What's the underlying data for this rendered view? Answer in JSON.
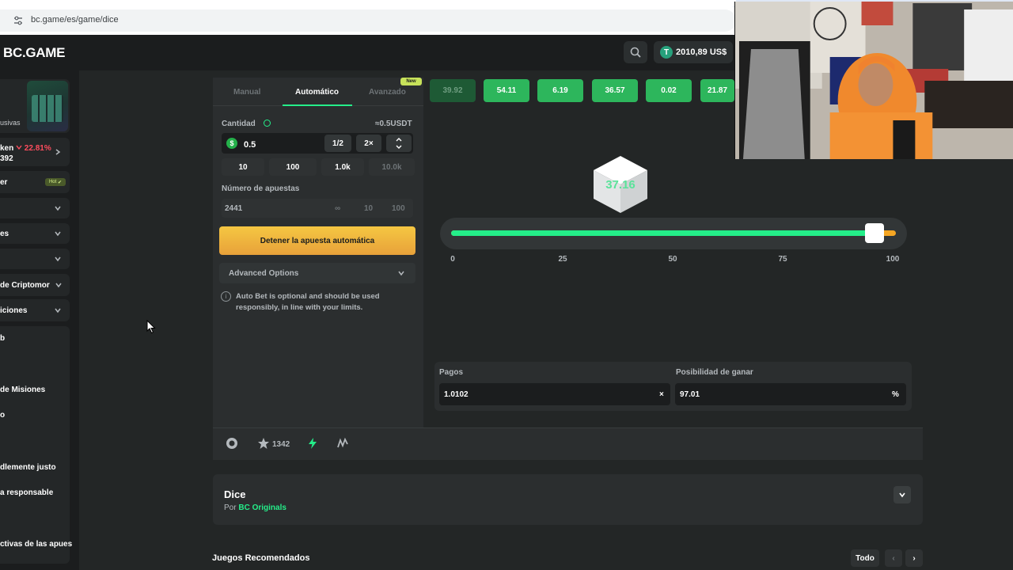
{
  "browser": {
    "url": "bc.game/es/game/dice"
  },
  "header": {
    "logo": "BC.GAME",
    "balance": "2010,89 US$",
    "balance_coin": "T"
  },
  "sidebar": {
    "promo_caption": "usivas",
    "token": {
      "name": "ken",
      "change": "22.81%",
      "value": "392"
    },
    "items": [
      {
        "label": "er",
        "badge": "Hot"
      },
      {
        "label": ""
      },
      {
        "label": "es"
      },
      {
        "label": ""
      },
      {
        "label": "de Criptomor"
      },
      {
        "label": "iciones"
      },
      {
        "label": "b"
      },
      {
        "label": "de Misiones"
      },
      {
        "label": "o"
      },
      {
        "label": "dlemente justo"
      },
      {
        "label": "a responsable"
      },
      {
        "label": "ctivas de las apues"
      }
    ]
  },
  "panel": {
    "tabs": [
      "Manual",
      "Automático",
      "Avanzado"
    ],
    "active_tab": "Automático",
    "new_badge": "New",
    "amount_label": "Cantidad",
    "amount_approx": "≈0.5USDT",
    "amount_value": "0.5",
    "amount_coin": "$",
    "half_btn": "1/2",
    "double_btn": "2×",
    "presets": [
      "10",
      "100",
      "1.0k",
      "10.0k"
    ],
    "bets_label": "Número de apuestas",
    "bets_value": "2441",
    "bets_options": [
      "∞",
      "10",
      "100"
    ],
    "stop_button": "Detener la apuesta automática",
    "advanced_label": "Advanced Options",
    "note_icon": "i",
    "note": "Auto Bet is optional and should be used responsibly, in line with your limits."
  },
  "game": {
    "history": [
      "39.92",
      "54.11",
      "6.19",
      "36.57",
      "0.02",
      "21.87"
    ],
    "result": "37.16",
    "slider_value": 97.01,
    "ticks": [
      "0",
      "25",
      "50",
      "75",
      "100"
    ],
    "payout_label": "Pagos",
    "payout_value": "1.0102",
    "payout_unit": "×",
    "chance_label": "Posibilidad de ganar",
    "chance_value": "97.01",
    "chance_unit": "%"
  },
  "bottom_bar": {
    "favorites": "1342"
  },
  "game_info": {
    "title": "Dice",
    "by_prefix": "Por",
    "provider": "BC Originals"
  },
  "recommended": {
    "title": "Juegos Recomendados",
    "all_button": "Todo",
    "prev": "‹",
    "next": "›"
  },
  "colors": {
    "accent_green": "#24ee89",
    "stop_button": "#f5c742",
    "background": "#232626",
    "panel": "#2b2e2f"
  }
}
